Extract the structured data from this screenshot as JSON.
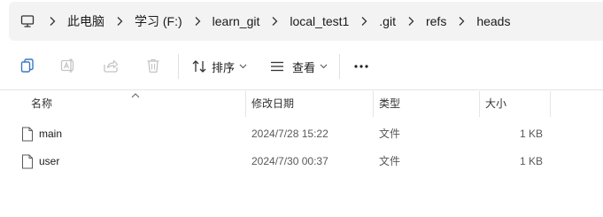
{
  "breadcrumb": {
    "items": [
      "此电脑",
      "学习 (F:)",
      "learn_git",
      "local_test1",
      ".git",
      "refs",
      "heads"
    ]
  },
  "toolbar": {
    "sort_label": "排序",
    "view_label": "查看"
  },
  "columns": {
    "name": "名称",
    "date": "修改日期",
    "type": "类型",
    "size": "大小"
  },
  "files": [
    {
      "name": "main",
      "date": "2024/7/28 15:22",
      "type": "文件",
      "size": "1 KB"
    },
    {
      "name": "user",
      "date": "2024/7/30 00:37",
      "type": "文件",
      "size": "1 KB"
    }
  ],
  "colors": {
    "address_bg": "#f3f3f3",
    "icon_active": "#3a78c2",
    "icon_disabled": "#c4c4c4"
  },
  "icons": {
    "computer": "computer-icon",
    "chevron": "chevron-right-icon",
    "copy": "copy-icon",
    "rename": "rename-icon",
    "share": "share-icon",
    "delete": "delete-icon",
    "sort": "sort-icon",
    "view": "view-icon",
    "more": "more-icon",
    "file": "file-icon"
  }
}
